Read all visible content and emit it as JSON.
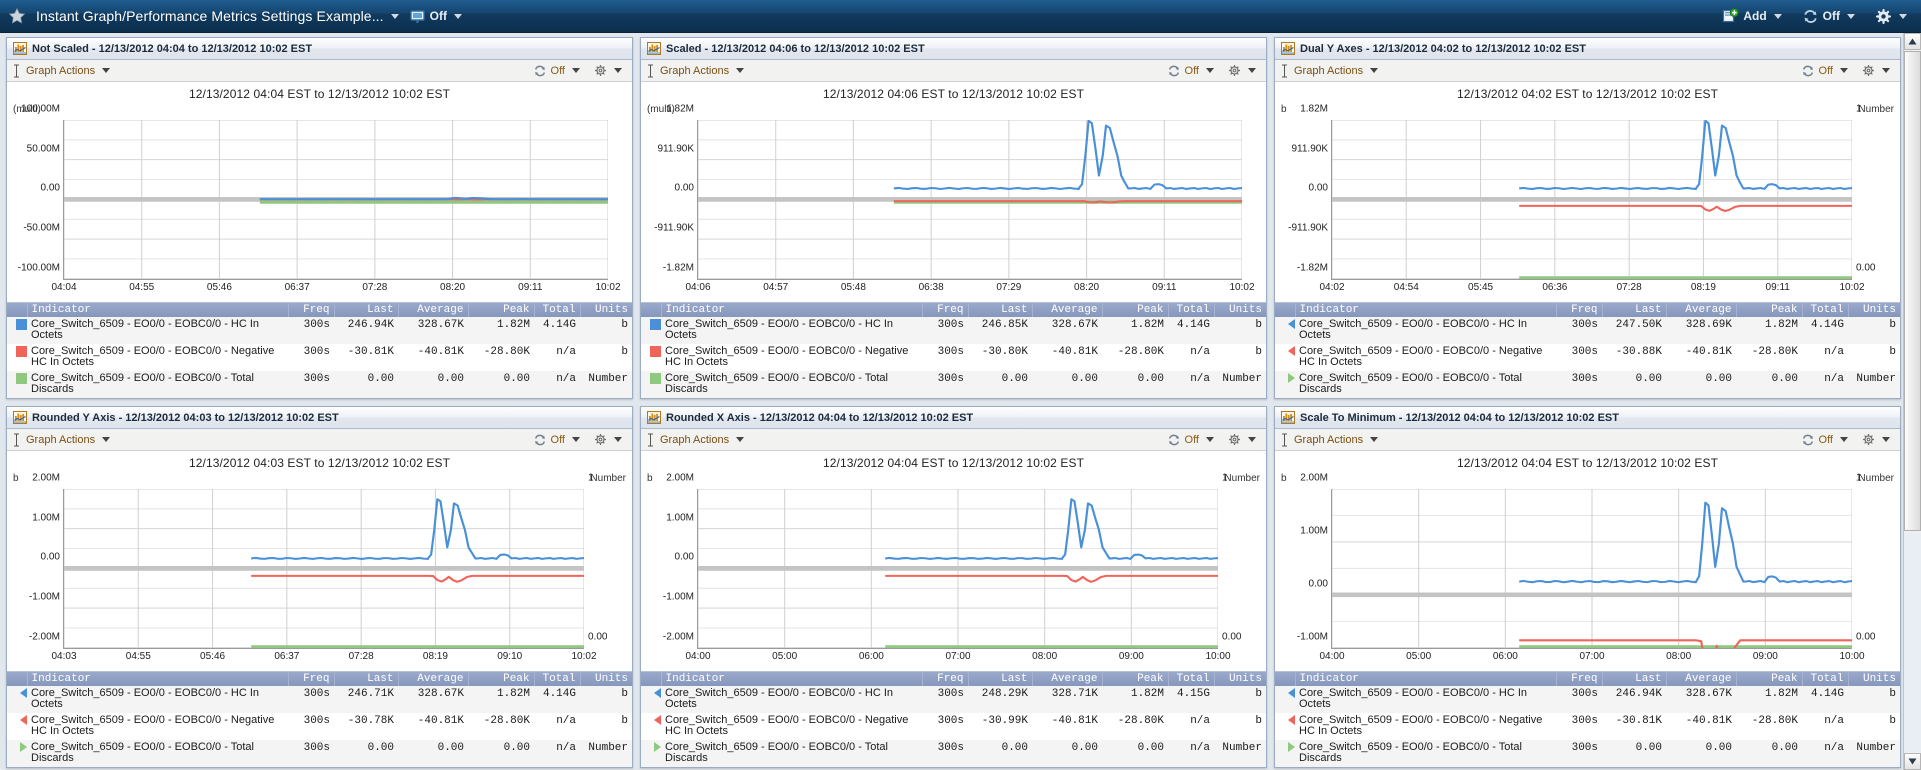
{
  "header": {
    "star_icon": "star-icon",
    "title": "Instant Graph/Performance Metrics Settings Example...",
    "presentation_icon": "presentation-mode-icon",
    "presentation_label": "Off",
    "add_icon": "add-icon",
    "add_label": "Add",
    "refresh_icon": "refresh-icon",
    "refresh_label": "Off",
    "settings_icon": "gear-icon"
  },
  "toolbar": {
    "graph_actions_icon": "i-beam-cursor-icon",
    "graph_actions_label": "Graph Actions",
    "refresh_icon": "refresh-icon",
    "refresh_label": "Off",
    "settings_icon": "gear-icon"
  },
  "legend_columns": [
    "Indicator",
    "Freq",
    "Last",
    "Average",
    "Peak",
    "Total",
    "Units"
  ],
  "colors": {
    "series_blue": "#4a90d9",
    "series_red": "#f0645a",
    "series_green": "#8ec97f",
    "header_blue": "#0d2f4e",
    "legend_header": "#8697bd",
    "grid": "#cfcfcf"
  },
  "panels": [
    {
      "id": "not-scaled",
      "title": "Not Scaled - 12/13/2012 04:04 to 12/13/2012 10:02 EST",
      "chart_data": {
        "type": "line",
        "title": "12/13/2012 04:04 EST to 12/13/2012 10:02 EST",
        "ylabel": "(multi)",
        "y2label": "",
        "dual_axis": false,
        "grid": true,
        "legend_position": "below",
        "ylim": [
          -100000000,
          100000000
        ],
        "yticks": [
          "-100.00M",
          "-50.00M",
          "0.00",
          "50.00M",
          "100.00M"
        ],
        "yticks_right": [],
        "xticks": [
          "04:04",
          "04:55",
          "05:46",
          "06:37",
          "07:28",
          "08:20",
          "09:11",
          "10:02"
        ],
        "series": [
          {
            "name": "HC In Octets",
            "color": "#4a90d9",
            "peak": 1820000,
            "flat_value": 250000
          },
          {
            "name": "Negative HC In Octets",
            "color": "#f0645a",
            "peak": -28800,
            "flat_value": -40810
          },
          {
            "name": "Total Discards",
            "color": "#8ec97f",
            "peak": 0,
            "flat_value": 0
          }
        ]
      },
      "rows": [
        {
          "marker": "square",
          "color": "#4a90d9",
          "indicator": "Core_Switch_6509 - EO0/0 - EOBC0/0 - HC In Octets",
          "freq": "300s",
          "last": "246.94K",
          "average": "328.67K",
          "peak": "1.82M",
          "total": "4.14G",
          "units": "b"
        },
        {
          "marker": "square",
          "color": "#f0645a",
          "indicator": "Core_Switch_6509 - EO0/0 - EOBC0/0 - Negative HC In Octets",
          "freq": "300s",
          "last": "-30.81K",
          "average": "-40.81K",
          "peak": "-28.80K",
          "total": "n/a",
          "units": "b"
        },
        {
          "marker": "square",
          "color": "#8ec97f",
          "indicator": "Core_Switch_6509 - EO0/0 - EOBC0/0 - Total Discards",
          "freq": "300s",
          "last": "0.00",
          "average": "0.00",
          "peak": "0.00",
          "total": "n/a",
          "units": "Number"
        }
      ]
    },
    {
      "id": "scaled",
      "title": "Scaled - 12/13/2012 04:06 to 12/13/2012 10:02 EST",
      "chart_data": {
        "type": "line",
        "title": "12/13/2012 04:06 EST to 12/13/2012 10:02 EST",
        "ylabel": "(multi)",
        "y2label": "",
        "dual_axis": false,
        "grid": true,
        "legend_position": "below",
        "ylim": [
          -1820000,
          1820000
        ],
        "yticks": [
          "-1.82M",
          "-911.90K",
          "0.00",
          "911.90K",
          "1.82M"
        ],
        "yticks_right": [],
        "xticks": [
          "04:06",
          "04:57",
          "05:48",
          "06:38",
          "07:29",
          "08:20",
          "09:11",
          "10:02"
        ],
        "series": [
          {
            "name": "HC In Octets",
            "color": "#4a90d9",
            "peak": 1820000,
            "flat_value": 250000
          },
          {
            "name": "Negative HC In Octets",
            "color": "#f0645a",
            "peak": -28800,
            "flat_value": -40810
          },
          {
            "name": "Total Discards",
            "color": "#8ec97f",
            "peak": 0,
            "flat_value": 0
          }
        ]
      },
      "rows": [
        {
          "marker": "square",
          "color": "#4a90d9",
          "indicator": "Core_Switch_6509 - EO0/0 - EOBC0/0 - HC In Octets",
          "freq": "300s",
          "last": "246.85K",
          "average": "328.67K",
          "peak": "1.82M",
          "total": "4.14G",
          "units": "b"
        },
        {
          "marker": "square",
          "color": "#f0645a",
          "indicator": "Core_Switch_6509 - EO0/0 - EOBC0/0 - Negative HC In Octets",
          "freq": "300s",
          "last": "-30.80K",
          "average": "-40.81K",
          "peak": "-28.80K",
          "total": "n/a",
          "units": "b"
        },
        {
          "marker": "square",
          "color": "#8ec97f",
          "indicator": "Core_Switch_6509 - EO0/0 - EOBC0/0 - Total Discards",
          "freq": "300s",
          "last": "0.00",
          "average": "0.00",
          "peak": "0.00",
          "total": "n/a",
          "units": "Number"
        }
      ]
    },
    {
      "id": "dual-y-axes",
      "title": "Dual Y Axes - 12/13/2012 04:02 to 12/13/2012 10:02 EST",
      "chart_data": {
        "type": "line",
        "title": "12/13/2012 04:02 EST to 12/13/2012 10:02 EST",
        "ylabel": "b",
        "y2label": "Number",
        "dual_axis": true,
        "grid": true,
        "legend_position": "below",
        "ylim": [
          -1820000,
          1820000
        ],
        "yticks": [
          "-1.82M",
          "-911.90K",
          "0.00",
          "911.90K",
          "1.82M"
        ],
        "yticks_right": [
          "0.00",
          "1"
        ],
        "xticks": [
          "04:02",
          "04:54",
          "05:45",
          "06:36",
          "07:28",
          "08:19",
          "09:11",
          "10:02"
        ],
        "series": [
          {
            "name": "HC In Octets",
            "color": "#4a90d9",
            "peak": 1820000,
            "flat_value": 250000
          },
          {
            "name": "Negative HC In Octets",
            "color": "#f0645a",
            "peak": -28800,
            "flat_value": -150000
          },
          {
            "name": "Total Discards",
            "color": "#8ec97f",
            "peak": 0,
            "flat_value": 0,
            "axis": "right"
          }
        ]
      },
      "rows": [
        {
          "marker": "tri-left",
          "color": "#4a90d9",
          "indicator": "Core_Switch_6509 - EO0/0 - EOBC0/0 - HC In Octets",
          "freq": "300s",
          "last": "247.50K",
          "average": "328.69K",
          "peak": "1.82M",
          "total": "4.14G",
          "units": "b"
        },
        {
          "marker": "tri-left",
          "color": "#f0645a",
          "indicator": "Core_Switch_6509 - EO0/0 - EOBC0/0 - Negative HC In Octets",
          "freq": "300s",
          "last": "-30.88K",
          "average": "-40.81K",
          "peak": "-28.80K",
          "total": "n/a",
          "units": "b"
        },
        {
          "marker": "tri-right",
          "color": "#8ec97f",
          "indicator": "Core_Switch_6509 - EO0/0 - EOBC0/0 - Total Discards",
          "freq": "300s",
          "last": "0.00",
          "average": "0.00",
          "peak": "0.00",
          "total": "n/a",
          "units": "Number"
        }
      ]
    },
    {
      "id": "rounded-y-axis",
      "title": "Rounded Y Axis - 12/13/2012 04:03 to 12/13/2012 10:02 EST",
      "chart_data": {
        "type": "line",
        "title": "12/13/2012 04:03 EST to 12/13/2012 10:02 EST",
        "ylabel": "b",
        "y2label": "Number",
        "dual_axis": true,
        "grid": true,
        "legend_position": "below",
        "ylim": [
          -2000000,
          2000000
        ],
        "yticks": [
          "-2.00M",
          "-1.00M",
          "0.00",
          "1.00M",
          "2.00M"
        ],
        "yticks_right": [
          "0.00",
          "1"
        ],
        "xticks": [
          "04:03",
          "04:55",
          "05:46",
          "06:37",
          "07:28",
          "08:19",
          "09:10",
          "10:02"
        ],
        "series": [
          {
            "name": "HC In Octets",
            "color": "#4a90d9",
            "peak": 1760000,
            "flat_value": 250000
          },
          {
            "name": "Negative HC In Octets",
            "color": "#f0645a",
            "peak": -28800,
            "flat_value": -190000
          },
          {
            "name": "Total Discards",
            "color": "#8ec97f",
            "peak": 0,
            "flat_value": 0,
            "axis": "right"
          }
        ]
      },
      "rows": [
        {
          "marker": "tri-left",
          "color": "#4a90d9",
          "indicator": "Core_Switch_6509 - EO0/0 - EOBC0/0 - HC In Octets",
          "freq": "300s",
          "last": "246.71K",
          "average": "328.67K",
          "peak": "1.82M",
          "total": "4.14G",
          "units": "b"
        },
        {
          "marker": "tri-left",
          "color": "#f0645a",
          "indicator": "Core_Switch_6509 - EO0/0 - EOBC0/0 - Negative HC In Octets",
          "freq": "300s",
          "last": "-30.78K",
          "average": "-40.81K",
          "peak": "-28.80K",
          "total": "n/a",
          "units": "b"
        },
        {
          "marker": "tri-right",
          "color": "#8ec97f",
          "indicator": "Core_Switch_6509 - EO0/0 - EOBC0/0 - Total Discards",
          "freq": "300s",
          "last": "0.00",
          "average": "0.00",
          "peak": "0.00",
          "total": "n/a",
          "units": "Number"
        }
      ]
    },
    {
      "id": "rounded-x-axis",
      "title": "Rounded X Axis - 12/13/2012 04:04 to 12/13/2012 10:02 EST",
      "chart_data": {
        "type": "line",
        "title": "12/13/2012 04:04 EST to 12/13/2012 10:02 EST",
        "ylabel": "b",
        "y2label": "Number",
        "dual_axis": true,
        "grid": true,
        "legend_position": "below",
        "ylim": [
          -2000000,
          2000000
        ],
        "yticks": [
          "-2.00M",
          "-1.00M",
          "0.00",
          "1.00M",
          "2.00M"
        ],
        "yticks_right": [
          "0.00",
          "1"
        ],
        "xticks": [
          "04:00",
          "05:00",
          "06:00",
          "07:00",
          "08:00",
          "09:00",
          "10:00"
        ],
        "series": [
          {
            "name": "HC In Octets",
            "color": "#4a90d9",
            "peak": 1760000,
            "flat_value": 250000
          },
          {
            "name": "Negative HC In Octets",
            "color": "#f0645a",
            "peak": -28800,
            "flat_value": -190000
          },
          {
            "name": "Total Discards",
            "color": "#8ec97f",
            "peak": 0,
            "flat_value": 0,
            "axis": "right"
          }
        ]
      },
      "rows": [
        {
          "marker": "tri-left",
          "color": "#4a90d9",
          "indicator": "Core_Switch_6509 - EO0/0 - EOBC0/0 - HC In Octets",
          "freq": "300s",
          "last": "248.29K",
          "average": "328.71K",
          "peak": "1.82M",
          "total": "4.15G",
          "units": "b"
        },
        {
          "marker": "tri-left",
          "color": "#f0645a",
          "indicator": "Core_Switch_6509 - EO0/0 - EOBC0/0 - Negative HC In Octets",
          "freq": "300s",
          "last": "-30.99K",
          "average": "-40.81K",
          "peak": "-28.80K",
          "total": "n/a",
          "units": "b"
        },
        {
          "marker": "tri-right",
          "color": "#8ec97f",
          "indicator": "Core_Switch_6509 - EO0/0 - EOBC0/0 - Total Discards",
          "freq": "300s",
          "last": "0.00",
          "average": "0.00",
          "peak": "0.00",
          "total": "n/a",
          "units": "Number"
        }
      ]
    },
    {
      "id": "scale-to-minimum",
      "title": "Scale To Minimum - 12/13/2012 04:04 to 12/13/2012 10:02 EST",
      "chart_data": {
        "type": "line",
        "title": "12/13/2012 04:04 EST to 12/13/2012 10:02 EST",
        "ylabel": "b",
        "y2label": "Number",
        "dual_axis": true,
        "grid": true,
        "legend_position": "below",
        "ylim": [
          -1000000,
          2000000
        ],
        "yticks": [
          "-1.00M",
          "0.00",
          "1.00M",
          "2.00M"
        ],
        "yticks_right": [
          "0.00",
          "1"
        ],
        "xticks": [
          "04:00",
          "05:00",
          "06:00",
          "07:00",
          "08:00",
          "09:00",
          "10:00"
        ],
        "series": [
          {
            "name": "HC In Octets",
            "color": "#4a90d9",
            "peak": 1760000,
            "flat_value": 250000
          },
          {
            "name": "Negative HC In Octets",
            "color": "#f0645a",
            "peak": -28800,
            "flat_value": -860000
          },
          {
            "name": "Total Discards",
            "color": "#8ec97f",
            "peak": 0,
            "flat_value": 0,
            "axis": "right"
          }
        ]
      },
      "rows": [
        {
          "marker": "tri-left",
          "color": "#4a90d9",
          "indicator": "Core_Switch_6509 - EO0/0 - EOBC0/0 - HC In Octets",
          "freq": "300s",
          "last": "246.94K",
          "average": "328.67K",
          "peak": "1.82M",
          "total": "4.14G",
          "units": "b"
        },
        {
          "marker": "tri-left",
          "color": "#f0645a",
          "indicator": "Core_Switch_6509 - EO0/0 - EOBC0/0 - Negative HC In Octets",
          "freq": "300s",
          "last": "-30.81K",
          "average": "-40.81K",
          "peak": "-28.80K",
          "total": "n/a",
          "units": "b"
        },
        {
          "marker": "tri-right",
          "color": "#8ec97f",
          "indicator": "Core_Switch_6509 - EO0/0 - EOBC0/0 - Total Discards",
          "freq": "300s",
          "last": "0.00",
          "average": "0.00",
          "peak": "0.00",
          "total": "n/a",
          "units": "Number"
        }
      ]
    }
  ]
}
